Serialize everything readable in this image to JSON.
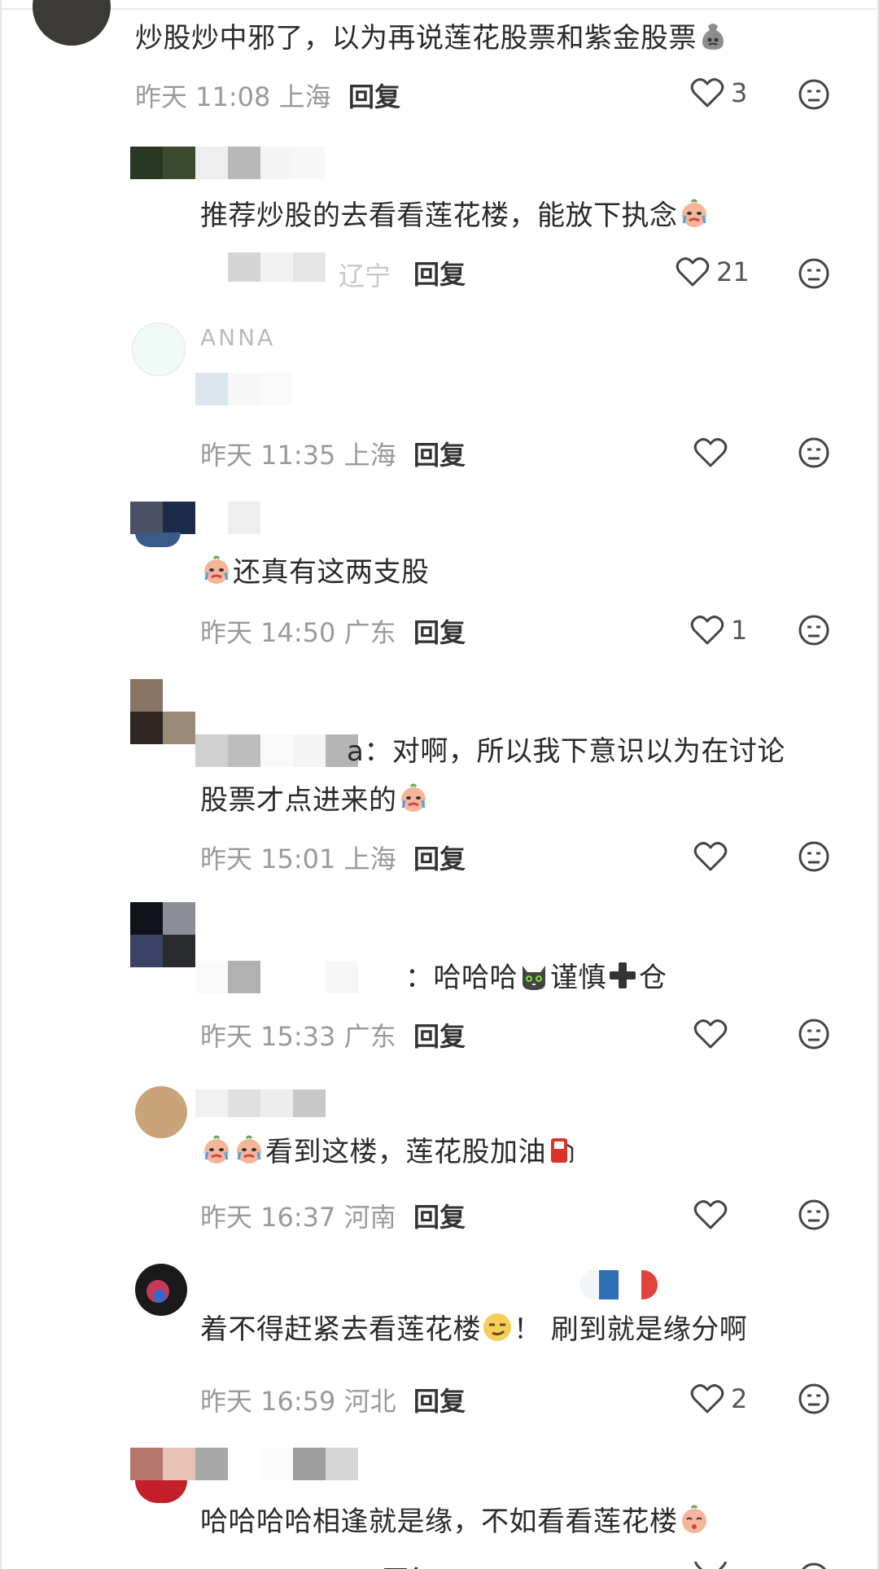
{
  "comments": [
    {
      "text": "炒股炒中邪了，以为再说莲花股票和紫金股票",
      "meta": "昨天 11:08 上海",
      "reply": "回复",
      "likes": "3"
    },
    {
      "text": "推荐炒股的去看看莲花楼，能放下执念",
      "meta": "",
      "reply": "回复",
      "likes": "21"
    },
    {
      "name_fragment": "ANNA",
      "text": "",
      "meta": "昨天 11:35 上海",
      "reply": "回复",
      "likes": ""
    },
    {
      "text": "还真有这两支股",
      "meta": "昨天 14:50 广东",
      "reply": "回复",
      "likes": "1"
    },
    {
      "text_line1_fragment": "a：对啊，所以我下意识以为在讨论",
      "text_line2": "股票才点进来的",
      "meta": "昨天 15:01 上海",
      "reply": "回复",
      "likes": ""
    },
    {
      "text_fragment": "：哈哈哈",
      "text_tail": "谨慎",
      "text_end": "仓",
      "meta": "昨天 15:33 广东",
      "reply": "回复",
      "likes": ""
    },
    {
      "text": "看到这楼，莲花股加油",
      "meta": "昨天 16:37 河南",
      "reply": "回复",
      "likes": ""
    },
    {
      "text_a": "着不得赶紧去看莲花楼",
      "text_b": "！ 刷到就是缘分啊",
      "meta": "昨天 16:59 河北",
      "reply": "回复",
      "likes": "2"
    },
    {
      "text": "哈哈哈哈相逢就是缘，不如看看莲花楼",
      "meta": "",
      "reply": "回复",
      "likes": ""
    }
  ],
  "partial_meta_2": "辽宁",
  "colors": {
    "text": "#2a2a2a",
    "meta": "#9a9a9a",
    "icon": "#333333"
  },
  "icons": {
    "like": "heart-outline-icon",
    "dislike": "neutral-face-icon"
  }
}
